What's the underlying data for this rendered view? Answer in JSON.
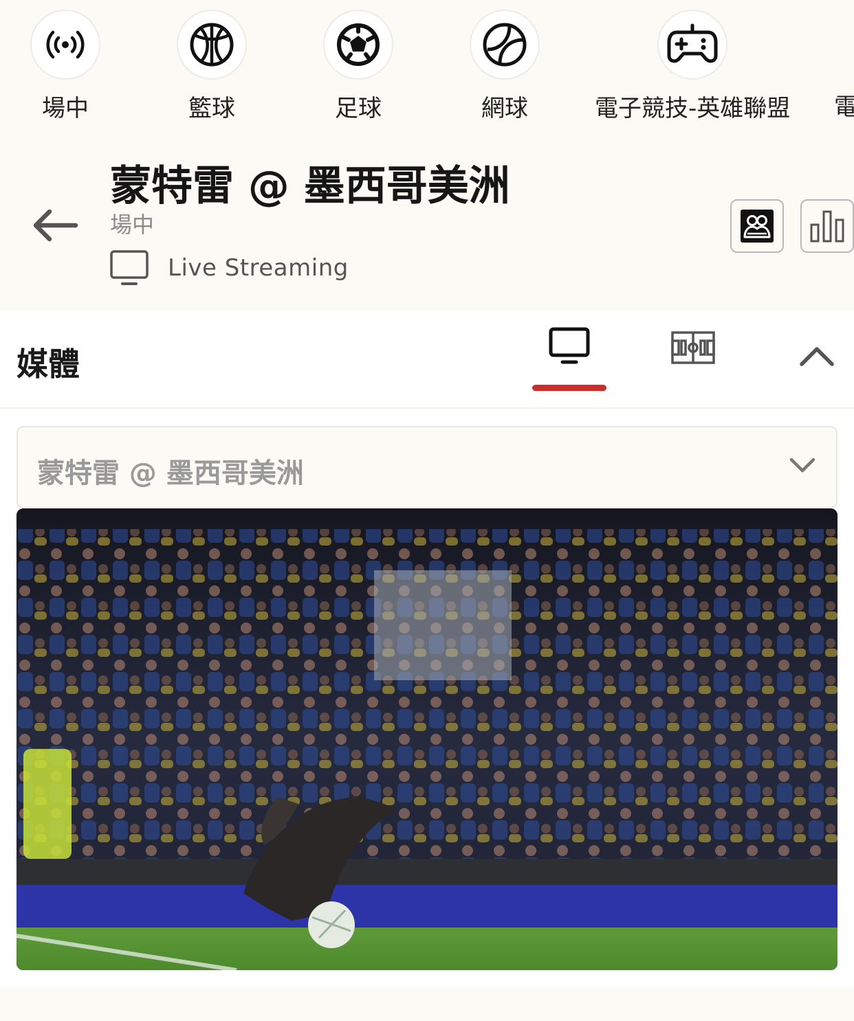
{
  "sports_nav": {
    "items": [
      {
        "label": "場中",
        "icon": "live-broadcast-icon"
      },
      {
        "label": "籃球",
        "icon": "basketball-icon"
      },
      {
        "label": "足球",
        "icon": "soccer-ball-icon"
      },
      {
        "label": "網球",
        "icon": "tennis-ball-icon"
      },
      {
        "label": "電子競技-英雄聯盟",
        "icon": "gamepad-icon"
      },
      {
        "label": "電",
        "icon": ""
      }
    ]
  },
  "match": {
    "title": "蒙特雷 @ 墨西哥美洲",
    "status": "場中",
    "streaming_label": "Live Streaming"
  },
  "media": {
    "title": "媒體",
    "selected_match": "蒙特雷 @ 墨西哥美洲",
    "active_tab": "video",
    "accent_color": "#c5302c"
  }
}
